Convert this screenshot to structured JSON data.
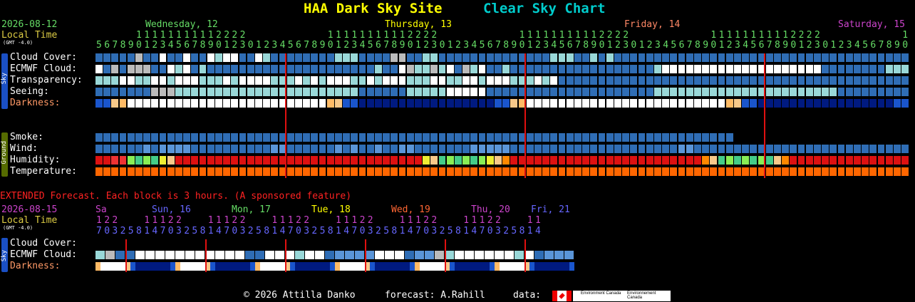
{
  "header": {
    "site": "HAA Dark Sky Site",
    "chart_name": "Clear Sky Chart",
    "site_color": "#ffff00",
    "chart_color": "#00cccc"
  },
  "top": {
    "date": "2026-08-12",
    "local_time": "Local Time",
    "gmt": "(GMT -4.0)",
    "days": [
      {
        "label": "Wednesday, 12",
        "color": "#66dd66"
      },
      {
        "label": "Thursday, 13",
        "color": "#ffff00"
      },
      {
        "label": "Friday, 14",
        "color": "#ff8866"
      },
      {
        "label": "Saturday, 15",
        "color": "#cc44cc"
      }
    ],
    "hours": [
      5,
      6,
      7,
      8,
      9,
      10,
      11,
      12,
      13,
      14,
      15,
      16,
      17,
      18,
      19,
      20,
      21,
      22,
      23,
      0,
      1,
      2,
      3,
      4,
      5,
      6,
      7,
      8,
      9,
      10,
      11,
      12,
      13,
      14,
      15,
      16,
      17,
      18,
      19,
      20,
      21,
      22,
      23,
      0,
      1,
      2,
      3,
      4,
      5,
      6,
      7,
      8,
      9,
      10,
      11,
      12,
      13,
      14,
      15,
      16,
      17,
      18,
      19,
      20,
      21,
      22,
      23,
      0,
      1,
      2,
      3,
      4,
      5,
      6,
      7,
      8,
      9,
      10,
      11,
      12,
      13,
      14,
      15,
      16,
      17,
      18,
      19,
      20,
      21,
      22,
      23,
      0,
      1,
      2,
      3,
      4,
      5,
      6,
      7,
      8,
      9,
      10,
      11,
      12,
      13,
      14
    ],
    "sky_tab": "Sky",
    "ground_tab": "Ground",
    "rows_sky": [
      {
        "label": "Cloud Cover:",
        "color": "#ffffff",
        "cells": "bbbbbmbbwbbwbbwcwwbbwcbbbbbbbbcccbbbbmmbbccbbbbbbbbbbbbbbcccbbcbcbbbbbbbbbbbbbbbbbbbbbbbbbbbbbbbbbbbbbbbbbbbbbbbbbbbcbbbbbbbbbbbbbbbbbbbbbbb"
      },
      {
        "label": "ECMWF Cloud:",
        "color": "#ffffff",
        "cells": "wbmbmmmbbwcwbcbbbbbbbbbbbbbbbbbbbbbcbbwmccmcwbmcwbbcbbbbbbbbbbbbbbbbbbcwwwwwwwwwwwwwwwwwwwwbbbbbbbbcccccccccccccccccccc"
      },
      {
        "label": "Transparency:",
        "color": "#ffffff",
        "cells": "cccwwccwwcwwwcccwcwwwwcccwcwcwwwccwcwwwcccwwccwwcwwwcccwcwbbbbbbbbbbbbbbbbbbbbbbbbbbbbbbbbbbbbbbbbbbbbbbbbbbbbbbbbbbbbbbb"
      },
      {
        "label": "Seeing:",
        "color": "#ffffff",
        "cells": "bbbbbbbmmmcccccccccccccccccccccccbbbbbbcccccwwwwwbbbbbbbbbbbbbbbbbbbbbcccccccccccccccccccccccbbbbbbbbbbbccccccccccccccccccccccccccccccccbbbbbbbbbcccccccbbbbbbbbbb"
      },
      {
        "label": "Darkness:",
        "color": "#ff9966",
        "cells": "ddykwwwwwwwwwwwwwwwwwwwwwwwwwkyddNNNNNNNNNNNNNNNNNddykwwwwwwwwwwwwwwwwwwwwwwwwwkyddNNNNNNNNNNNNNNNNNddykwwwwwwwwwwwwwwwwwwwwwwwwwkyddNNNNNNNNNNNNNNNddykwwwwwwwwwwwwwwwwwwwwww"
      }
    ],
    "rows_ground": [
      {
        "label": "Smoke:",
        "color": "#ffffff",
        "cells": "bbbbbbbbbbbbbbbbbbbbbbbbbbbbbbbbbbbbbbbbbbbbbbbbbbbbbbbbbbbbbbbbbbbbbbbbbbbbbbbbbbbbbbbbbbbbbbbbbbb"
      },
      {
        "label": "Wind:",
        "color": "#ffffff",
        "cells": "bbbbbbBbBBBBbbbbbbbbbbBBbbbbbbBbBbbBbbBBbbbbbbbBBBBBbbbbbbbbbbbbbbbbbbbbbBBbbbbbbbbbbbbbbbbbbbbbbbbbbbbbbbbbbbbbbbbbbbbbbbbbbbbbbbbbbbbbbbbbbBBBbbbbbbbb"
      },
      {
        "label": "Humidity:",
        "color": "#ffffff",
        "cells": "rrRRgGgGYyrrrrrrrrrrrrrrrrrrrrrrrrrrrrrrrYyGgGgGgYyOrrrrrrrrrrrrrrrrrrrrrrrrOyGgGgGgGyOrrrrrrrrrrrrrrrrrYyGgGgGg"
      },
      {
        "label": "Temperature:",
        "color": "#ffffff",
        "cells": "ooooooooooooooooooooooooooooooooooooooooooooooooooooooooooooooooooooooooooooooooooooooooooooooooooooooooooooooooooooooooo"
      }
    ]
  },
  "extended": {
    "banner": "EXTENDED Forecast. Each block is 3 hours. (A sponsored feature)",
    "banner_color": "#ff2222",
    "date": "2026-08-15",
    "local_time": "Local Time",
    "gmt": "(GMT -4.0)",
    "days": [
      {
        "label": "Sa",
        "color": "#cc44cc"
      },
      {
        "label": "Sun, 16",
        "color": "#6666ff"
      },
      {
        "label": "Mon, 17",
        "color": "#66dd66"
      },
      {
        "label": "Tue, 18",
        "color": "#ffff00"
      },
      {
        "label": "Wed, 19",
        "color": "#ff6633"
      },
      {
        "label": "Thu, 20",
        "color": "#cc44cc"
      },
      {
        "label": "Fri, 21",
        "color": "#6666ff"
      }
    ],
    "hours": [
      17,
      20,
      23,
      2,
      5,
      8,
      11,
      14,
      17,
      20,
      23,
      2,
      5,
      8,
      11,
      14,
      17,
      20,
      23,
      2,
      5,
      8,
      11,
      14,
      17,
      20,
      23,
      2,
      5,
      8,
      11,
      14,
      17,
      20,
      23,
      2,
      5,
      8,
      11,
      14,
      17,
      20,
      23,
      2,
      5,
      8,
      11,
      14,
      17,
      20,
      23,
      2,
      5,
      8,
      11,
      14
    ],
    "sky_tab": "Sky",
    "rows": [
      {
        "label": "Cloud Cover:",
        "color": "#ffffff"
      },
      {
        "label": "ECMWF Cloud:",
        "color": "#ffffff",
        "cells": "cmbbwwwwwwwwwwwbbwwwcwwbBBBBwwwbBBmcwwwwwwcwbBBBBwww"
      },
      {
        "label": "Darkness:",
        "color": "#ff9966"
      }
    ]
  },
  "footer": {
    "copyright": "© 2026 Attilla Danko",
    "forecast": "forecast: A.Rahill",
    "data": "data:",
    "sponsor": "Environment Canada",
    "sponsor2": "Environnement Canada"
  },
  "chart_data": {
    "type": "heatmap",
    "title": "HAA Dark Sky Site Clear Sky Chart",
    "date_start": "2026-08-12",
    "rows": [
      "Cloud Cover:",
      "ECMWF Cloud:",
      "Transparency:",
      "Seeing:",
      "Darkness:",
      "Smoke:",
      "Wind:",
      "Humidity:",
      "Temperature:"
    ],
    "extended_rows": [
      "Cloud Cover:",
      "ECMWF Cloud:",
      "Darkness:"
    ],
    "hour_step_top": 1,
    "hour_step_extended": 3
  }
}
